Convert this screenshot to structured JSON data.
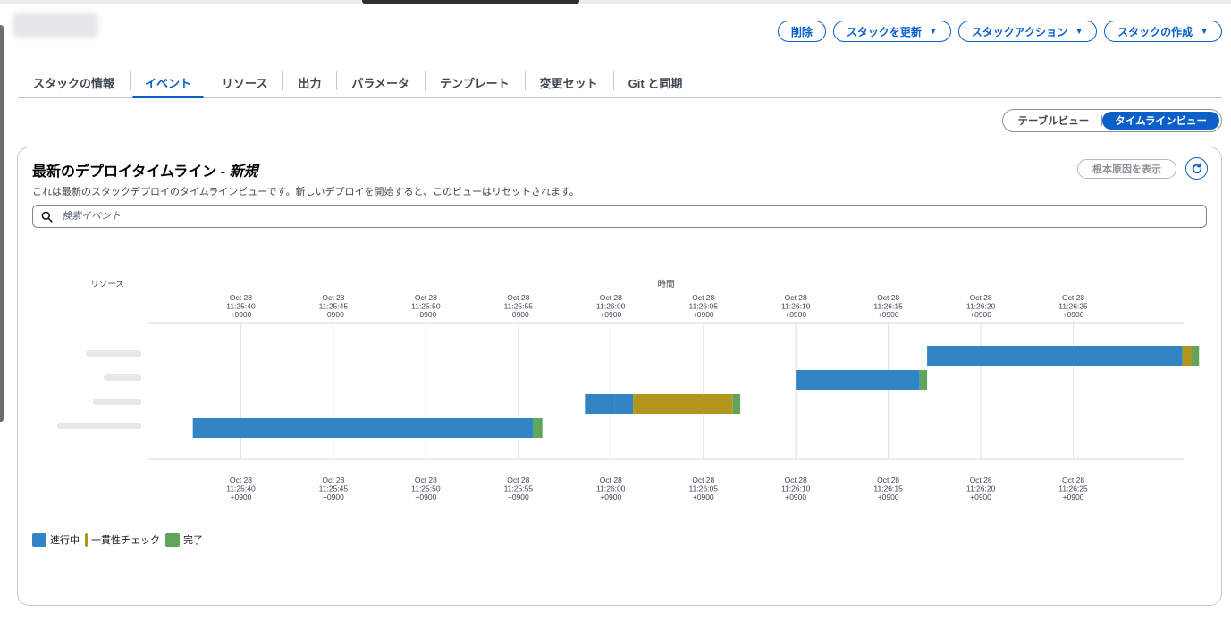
{
  "header": {
    "actions": [
      {
        "label": "削除",
        "dropdown": false
      },
      {
        "label": "スタックを更新",
        "dropdown": true
      },
      {
        "label": "スタックアクション",
        "dropdown": true
      },
      {
        "label": "スタックの作成",
        "dropdown": true
      }
    ]
  },
  "tabs": [
    {
      "label": "スタックの情報",
      "active": false
    },
    {
      "label": "イベント",
      "active": true
    },
    {
      "label": "リソース",
      "active": false
    },
    {
      "label": "出力",
      "active": false
    },
    {
      "label": "パラメータ",
      "active": false
    },
    {
      "label": "テンプレート",
      "active": false
    },
    {
      "label": "変更セット",
      "active": false
    },
    {
      "label": "Git と同期",
      "active": false
    }
  ],
  "view_toggle": {
    "options": [
      {
        "label": "テーブルビュー",
        "active": false
      },
      {
        "label": "タイムラインビュー",
        "active": true
      }
    ]
  },
  "panel": {
    "title": "最新のデプロイタイムライン - ",
    "title_status": "新規",
    "description": "これは最新のスタックデプロイのタイムラインビューです。新しいデプロイを開始すると、このビューはリセットされます。",
    "root_cause_label": "根本原因を表示",
    "search_placeholder": "検索イベント"
  },
  "chart_data": {
    "type": "timeline",
    "y_label": "リソース",
    "x_label": "時間",
    "x_range": [
      "11:25:35",
      "11:26:30"
    ],
    "ticks": [
      [
        "Oct 28",
        "11:25:40",
        "+0900"
      ],
      [
        "Oct 28",
        "11:25:45",
        "+0900"
      ],
      [
        "Oct 28",
        "11:25:50",
        "+0900"
      ],
      [
        "Oct 28",
        "11:25:55",
        "+0900"
      ],
      [
        "Oct 28",
        "11:26:00",
        "+0900"
      ],
      [
        "Oct 28",
        "11:26:05",
        "+0900"
      ],
      [
        "Oct 28",
        "11:26:10",
        "+0900"
      ],
      [
        "Oct 28",
        "11:26:15",
        "+0900"
      ],
      [
        "Oct 28",
        "11:26:20",
        "+0900"
      ],
      [
        "Oct 28",
        "11:26:25",
        "+0900"
      ]
    ],
    "legend": [
      {
        "label": "進行中",
        "color": "#3184c6"
      },
      {
        "label": "一貫性チェック",
        "color": "#b4951f"
      },
      {
        "label": "完了",
        "color": "#5fa65a"
      }
    ],
    "rows": [
      {
        "segments": [
          {
            "status": "進行中",
            "start": "11:26:17.1",
            "end": "11:26:30.9"
          },
          {
            "status": "一貫性チェック",
            "start": "11:26:30.9",
            "end": "11:26:31.4"
          },
          {
            "status": "完了",
            "start": "11:26:31.4",
            "end": "11:26:31.8"
          }
        ]
      },
      {
        "segments": [
          {
            "status": "進行中",
            "start": "11:26:10.0",
            "end": "11:26:16.7"
          },
          {
            "status": "完了",
            "start": "11:26:16.7",
            "end": "11:26:17.1"
          }
        ]
      },
      {
        "segments": [
          {
            "status": "進行中",
            "start": "11:25:58.6",
            "end": "11:26:00.2"
          },
          {
            "status": "進行中",
            "start": "11:26:00.2",
            "end": "11:26:01.2"
          },
          {
            "status": "一貫性チェック",
            "start": "11:26:01.2",
            "end": "11:26:06.6"
          },
          {
            "status": "完了",
            "start": "11:26:06.6",
            "end": "11:26:07.0"
          }
        ]
      },
      {
        "segments": [
          {
            "status": "進行中",
            "start": "11:25:37.4",
            "end": "11:25:55.8"
          },
          {
            "status": "完了",
            "start": "11:25:55.8",
            "end": "11:25:56.3"
          }
        ]
      }
    ]
  }
}
